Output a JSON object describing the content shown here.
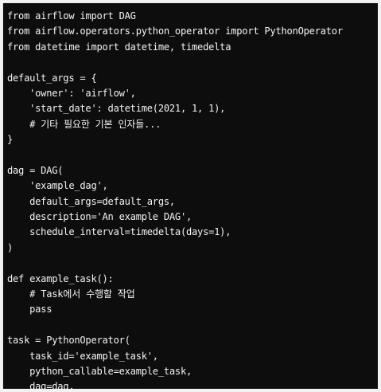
{
  "code": {
    "lines": [
      "from airflow import DAG",
      "from airflow.operators.python_operator import PythonOperator",
      "from datetime import datetime, timedelta",
      "",
      "default_args = {",
      "    'owner': 'airflow',",
      "    'start_date': datetime(2021, 1, 1),",
      "    # 기타 필요한 기본 인자들...",
      "}",
      "",
      "dag = DAG(",
      "    'example_dag',",
      "    default_args=default_args,",
      "    description='An example DAG',",
      "    schedule_interval=timedelta(days=1),",
      ")",
      "",
      "def example_task():",
      "    # Task에서 수행할 작업",
      "    pass",
      "",
      "task = PythonOperator(",
      "    task_id='example_task',",
      "    python_callable=example_task,",
      "    dag=dag,",
      ")"
    ]
  },
  "colors": {
    "editor_background": "#0d0d0d",
    "text": "#f3f3f3"
  }
}
